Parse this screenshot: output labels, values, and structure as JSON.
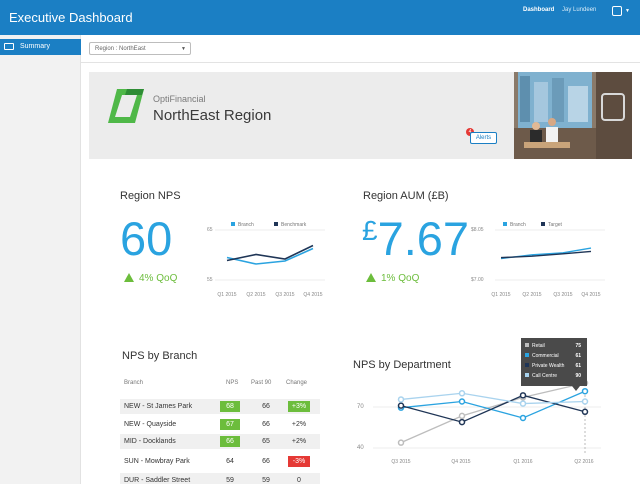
{
  "header": {
    "app_title": "Executive Dashboard",
    "nav_active": "Dashboard",
    "user_name": "Jay Lundeen",
    "color": "#1b7fc4"
  },
  "sidebar": {
    "items": [
      {
        "label": "Summary",
        "icon": "monitor-icon",
        "active": true
      }
    ]
  },
  "filter": {
    "selected": "Region : NorthEast"
  },
  "banner": {
    "company": "OptiFinancial",
    "region": "NorthEast Region",
    "alerts_label": "Alerts",
    "alerts_count": "4",
    "logo_color": "#4fb848"
  },
  "region_nps": {
    "title": "Region NPS",
    "value": "60",
    "change": "4% QoQ",
    "legend": [
      "Branch",
      "Benchmark"
    ]
  },
  "region_aum": {
    "title": "Region AUM (£B)",
    "currency": "£",
    "value": "7.67",
    "change": "1% QoQ",
    "legend": [
      "Branch",
      "Target"
    ]
  },
  "nps_by_branch": {
    "title": "NPS by Branch",
    "columns": [
      "Branch",
      "NPS",
      "Past 90",
      "Change"
    ],
    "rows": [
      {
        "branch": "NEW - St James Park",
        "nps": "68",
        "past": "66",
        "change": "+3%"
      },
      {
        "branch": "NEW - Quayside",
        "nps": "67",
        "past": "66",
        "change": "+2%"
      },
      {
        "branch": "MID - Docklands",
        "nps": "66",
        "past": "65",
        "change": "+2%"
      },
      {
        "branch": "SUN - Mowbray Park",
        "nps": "64",
        "past": "66",
        "change": "-3%"
      },
      {
        "branch": "DUR - Saddler Street",
        "nps": "59",
        "past": "59",
        "change": "0"
      }
    ]
  },
  "nps_by_department": {
    "title": "NPS by Department",
    "tooltip": [
      {
        "label": "Retail",
        "value": "75",
        "color": "#bdbdbd"
      },
      {
        "label": "Commercial",
        "value": "61",
        "color": "#2aa3e0"
      },
      {
        "label": "Private Wealth",
        "value": "61",
        "color": "#1f3556"
      },
      {
        "label": "Call Centre",
        "value": "90",
        "color": "#a9d3ee"
      }
    ]
  },
  "chart_data": [
    {
      "type": "line",
      "title": "Region NPS",
      "x": [
        "Q1 2015",
        "Q2 2015",
        "Q3 2015",
        "Q4 2015"
      ],
      "ylim": [
        55,
        65
      ],
      "yticks": [
        "65",
        "55"
      ],
      "series": [
        {
          "name": "Branch",
          "color": "#2aa3e0",
          "values": [
            59.5,
            58.2,
            58.8,
            61.3
          ]
        },
        {
          "name": "Benchmark",
          "color": "#1f3556",
          "values": [
            58.9,
            60.1,
            59.2,
            61.9
          ]
        }
      ]
    },
    {
      "type": "line",
      "title": "Region AUM (£B)",
      "x": [
        "Q1 2015",
        "Q2 2015",
        "Q3 2015",
        "Q4 2015"
      ],
      "ylim": [
        7.0,
        8.05
      ],
      "yticks": [
        "$8.05",
        "$7.00"
      ],
      "series": [
        {
          "name": "Branch",
          "color": "#2aa3e0",
          "values": [
            7.45,
            7.53,
            7.57,
            7.67
          ]
        },
        {
          "name": "Target",
          "color": "#1f3556",
          "values": [
            7.47,
            7.5,
            7.55,
            7.6
          ]
        }
      ]
    },
    {
      "type": "line",
      "title": "NPS by Department",
      "x": [
        "Q3 2015",
        "Q4 2015",
        "Q1 2016",
        "Q2 2016"
      ],
      "ylim": [
        40,
        75
      ],
      "yticks": [
        "70",
        "40"
      ],
      "series": [
        {
          "name": "Retail",
          "color": "#bdbdbd",
          "values": [
            46,
            59,
            68,
            75
          ]
        },
        {
          "name": "Commercial",
          "color": "#2aa3e0",
          "values": [
            63,
            66,
            58,
            71
          ]
        },
        {
          "name": "Private Wealth",
          "color": "#1f3556",
          "values": [
            64,
            56,
            69,
            61
          ]
        },
        {
          "name": "Call Centre",
          "color": "#a9d3ee",
          "values": [
            67,
            70,
            65,
            66
          ]
        }
      ]
    }
  ]
}
